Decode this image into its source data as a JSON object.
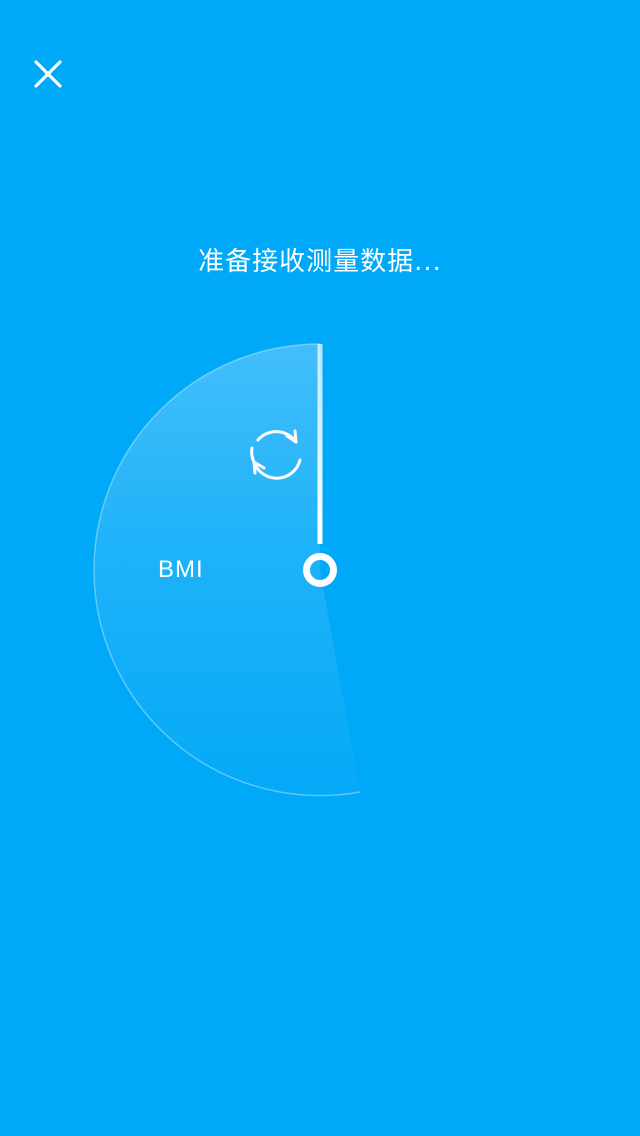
{
  "header": {
    "close_icon": "close-icon"
  },
  "status": {
    "text": "准备接收测量数据..."
  },
  "gauge": {
    "metric_label": "BMI",
    "refresh_icon": "refresh-cycle-icon",
    "pivot_icon": "pivot-ring-icon"
  },
  "colors": {
    "background": "#00a8f8",
    "foreground": "#ffffff"
  }
}
